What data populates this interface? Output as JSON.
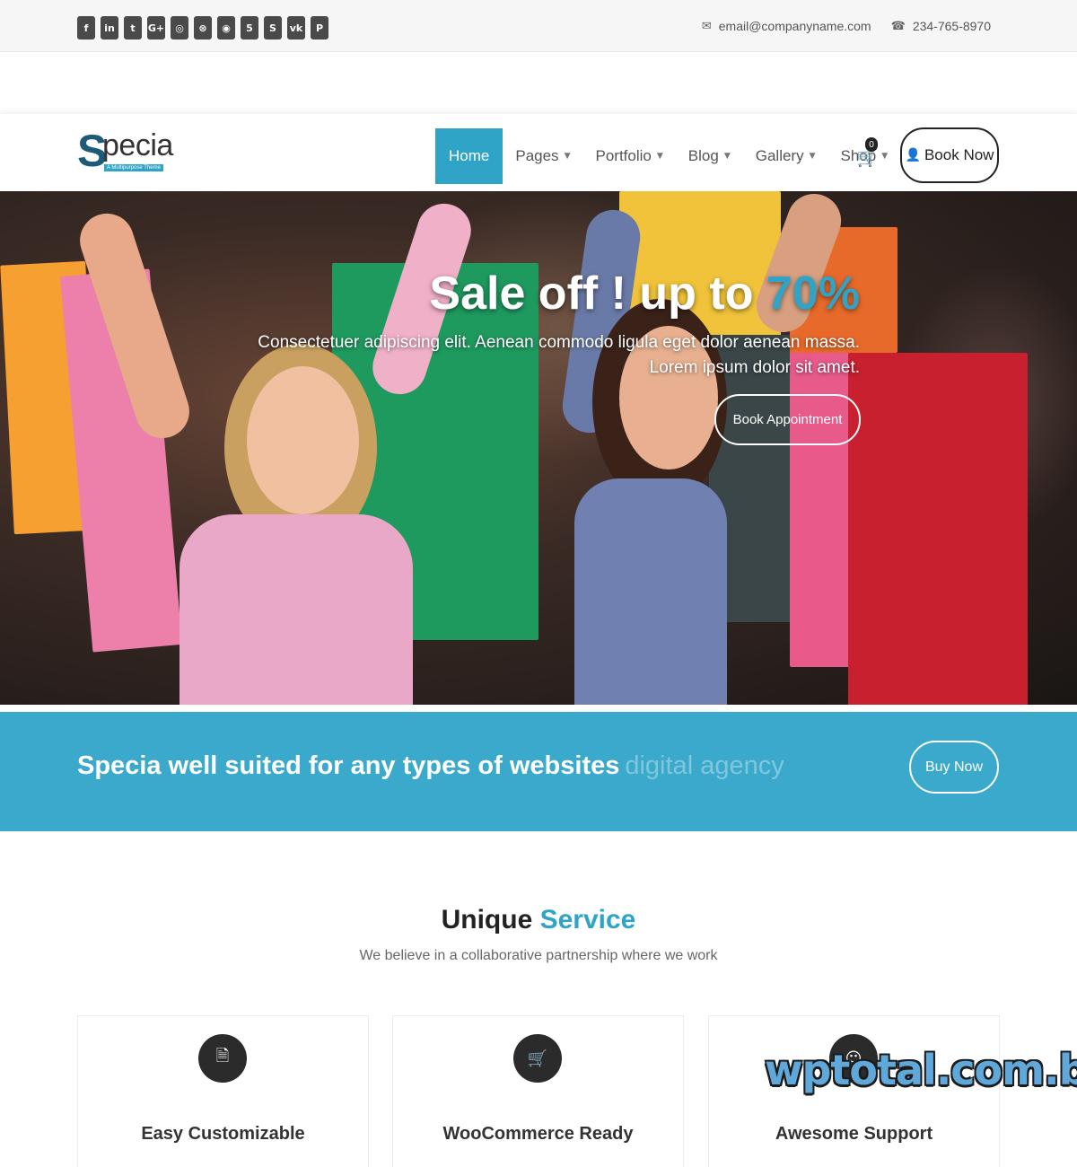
{
  "topbar": {
    "social_icons": [
      {
        "name": "facebook-icon",
        "glyph": "f"
      },
      {
        "name": "linkedin-icon",
        "glyph": "in"
      },
      {
        "name": "twitter-icon",
        "glyph": "t"
      },
      {
        "name": "google-plus-icon",
        "glyph": "G+"
      },
      {
        "name": "instagram-icon",
        "glyph": "◎"
      },
      {
        "name": "dribbble-icon",
        "glyph": "⊛"
      },
      {
        "name": "github-icon",
        "glyph": "◉"
      },
      {
        "name": "html5-icon",
        "glyph": "5"
      },
      {
        "name": "skype-icon",
        "glyph": "S"
      },
      {
        "name": "vk-icon",
        "glyph": "vk"
      },
      {
        "name": "pinterest-icon",
        "glyph": "P"
      }
    ],
    "email": "email@companyname.com",
    "phone": "234-765-8970"
  },
  "header": {
    "logo_letter": "S",
    "logo_rest": "pecia",
    "logo_tagline": "A Multipurpose Theme",
    "nav": [
      {
        "label": "Home",
        "active": true,
        "dropdown": false
      },
      {
        "label": "Pages",
        "active": false,
        "dropdown": true
      },
      {
        "label": "Portfolio",
        "active": false,
        "dropdown": true
      },
      {
        "label": "Blog",
        "active": false,
        "dropdown": true
      },
      {
        "label": "Gallery",
        "active": false,
        "dropdown": true
      },
      {
        "label": "Shop",
        "active": false,
        "dropdown": true
      }
    ],
    "cart_count": "0",
    "book_label": "Book Now"
  },
  "hero": {
    "title_main": "Sale off ! up to ",
    "title_accent": "70%",
    "subtitle": "Consectetuer adipiscing elit. Aenean commodo ligula eget dolor aenean massa. Lorem ipsum dolor sit amet.",
    "button_label": "Book Appointment"
  },
  "banner": {
    "text": "Specia well suited for any types of websites",
    "text_faded": "digital agency",
    "button_label": "Buy Now"
  },
  "services": {
    "title_main": "Unique ",
    "title_accent": "Service",
    "subtitle": "We believe in a collaborative partnership where we work",
    "cards": [
      {
        "label": "Easy Customizable",
        "icon": "document-icon"
      },
      {
        "label": "WooCommerce Ready",
        "icon": "cart-plus-icon"
      },
      {
        "label": "Awesome Support",
        "icon": "support-icon"
      }
    ]
  },
  "watermark": "wptotal.com.br",
  "colors": {
    "accent": "#2fa4c7",
    "banner": "#3ba9cb",
    "dark": "#2b2b2b"
  }
}
